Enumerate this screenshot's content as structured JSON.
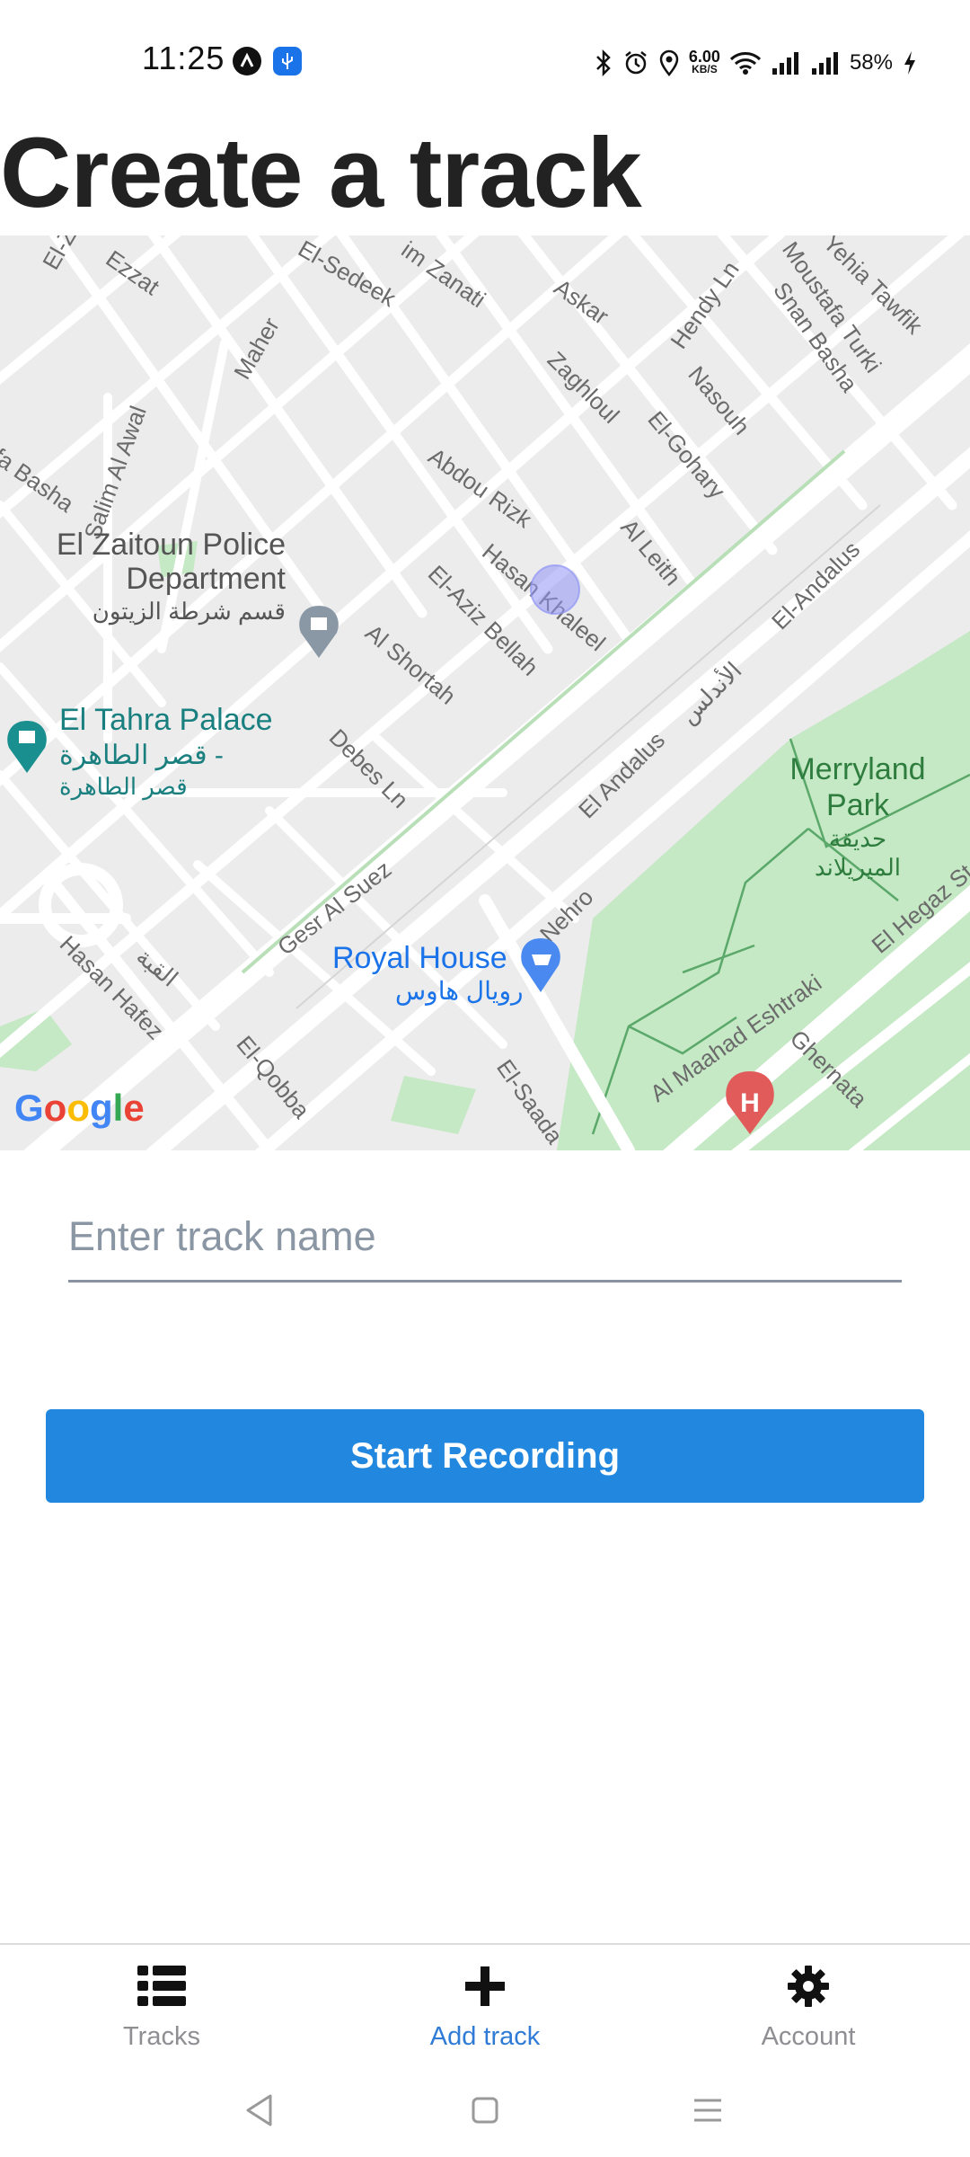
{
  "status_bar": {
    "time": "11:25",
    "net_speed_value": "6.00",
    "net_speed_unit": "KB/S",
    "battery": "58%",
    "app_icon_colors": [
      "#111111",
      "#1a73e8"
    ]
  },
  "page": {
    "title": "Create a track"
  },
  "map": {
    "attribution": "Google",
    "places": [
      {
        "name": "El Zaitoun Police",
        "name_line2": "Department",
        "arabic": "قسم شرطة الزيتون"
      },
      {
        "name": "El Tahra Palace",
        "name_line2": "قصر الطاهرة -",
        "arabic": "قصر الطاهرة"
      },
      {
        "name": "Royal House",
        "arabic": "رويال هاوس"
      },
      {
        "name": "Merryland",
        "name_line2": "Park",
        "arabic": "حديقة",
        "arabic_line2": "الميريلاند"
      }
    ],
    "streets": [
      "El-Za",
      "Ezzat",
      "El-Sedeek",
      "im Zanati",
      "Askar",
      "Hendy Ln",
      "Moustafa Turki",
      "Yehia Tawfik",
      "Snan Basha",
      "Maher",
      "Zaghloul",
      "Nasouh",
      "El-Gohary",
      "Abdou Rizk",
      "Salim Al Awal",
      "fa Basha",
      "Hasan Khaleel",
      "Al Leith",
      "El-Aziz Bellah",
      "El-Andalus",
      "Al Shortah",
      "الأندلس",
      "Debes Ln",
      "El Andalus",
      "Gesr Al Suez",
      "Nehro",
      "El Hegaz St",
      "Hasan Hafez",
      "القبة",
      "El-Qobba",
      "El-Saada",
      "Al Maahad Eshtraki",
      "Ghernata"
    ],
    "colors": {
      "land": "#ececec",
      "road": "#ffffff",
      "park": "#c5e8c5",
      "park_border": "#5aa86a",
      "place_teal": "#1a7f7f",
      "place_blue": "#1a73e8",
      "hospital": "#e25b5b"
    }
  },
  "form": {
    "track_name_placeholder": "Enter track name",
    "track_name_value": "",
    "start_button_label": "Start Recording"
  },
  "tabs": [
    {
      "label": "Tracks",
      "icon": "list-icon",
      "active": false
    },
    {
      "label": "Add track",
      "icon": "plus-icon",
      "active": true
    },
    {
      "label": "Account",
      "icon": "gear-icon",
      "active": false
    }
  ],
  "colors": {
    "accent": "#2287de",
    "active_tab": "#2f7bd6",
    "inactive_tab": "#8e8e93"
  }
}
